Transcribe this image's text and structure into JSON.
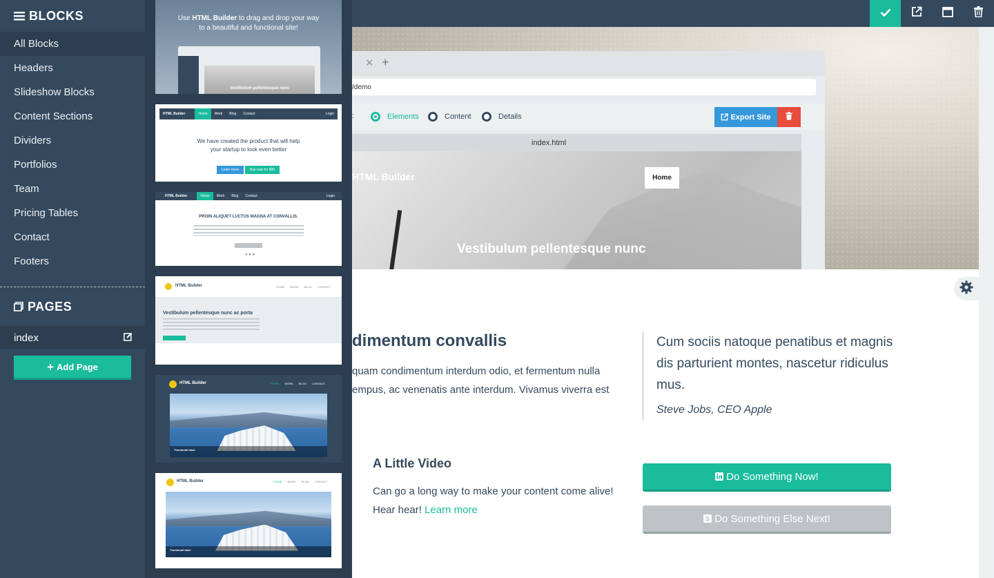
{
  "sidebar": {
    "blocks_title": "BLOCKS",
    "items": [
      {
        "label": "All Blocks"
      },
      {
        "label": "Headers"
      },
      {
        "label": "Slideshow Blocks"
      },
      {
        "label": "Content Sections"
      },
      {
        "label": "Dividers"
      },
      {
        "label": "Portfolios"
      },
      {
        "label": "Team"
      },
      {
        "label": "Pricing Tables"
      },
      {
        "label": "Contact"
      },
      {
        "label": "Footers"
      }
    ],
    "pages_title": "PAGES",
    "pages": [
      {
        "label": "index"
      }
    ],
    "add_page_label": "Add Page"
  },
  "thumbs": {
    "t1": {
      "line1a": "Use ",
      "line1b": "HTML Builder",
      "line1c": " to drag and drop your way",
      "line2": "to a beautiful and functional site!",
      "caption": "Vestibulum pellentesque nunc"
    },
    "t2": {
      "brand": "HTML Builder",
      "nav": [
        "Home",
        "Work",
        "Blog",
        "Contact"
      ],
      "login": "Login",
      "h1": "We have created the product that will help",
      "h2": "your startup to look even better",
      "btn1": "Learn more",
      "btn2": "Buy now for $99"
    },
    "t3": {
      "brand": "HTML Builder",
      "nav": [
        "Home",
        "Work",
        "Blog",
        "Contact"
      ],
      "login": "Login",
      "title": "PROIN ALIQUET LUCTUS MAGNA AT CONVALLIS."
    },
    "t4": {
      "brand": "HTML Builder",
      "nav": [
        "HOME",
        "WORK",
        "BLOG",
        "CONTACT"
      ],
      "title": "Vestibulum pellentesque nunc ac porta"
    },
    "t5": {
      "brand": "HTML Builder",
      "nav": [
        "HOME",
        "WORK",
        "BLOG",
        "CONTACT"
      ],
      "caption": "Thumbnail label"
    },
    "t6": {
      "brand": "HTML Builder",
      "nav": [
        "HOME",
        "WORK",
        "BLOG",
        "CONTACT"
      ],
      "caption": "Thumbnail label"
    }
  },
  "canvas": {
    "url_text": "/demo",
    "modes": [
      "Elements",
      "Content",
      "Details"
    ],
    "mode_prefix": ":",
    "export_label": "Export Site",
    "file_tab": "index.html",
    "inner_brand": "HTML Builder",
    "inner_home": "Home",
    "inner_caption": "Vestibulum pellentesque nunc",
    "section_heading": "dimentum convallis",
    "section_text": "quam condimentum interdum odio, et fermentum nulla empus, ac venenatis ante interdum. Vivamus viverra est",
    "quote": "Cum sociis natoque penatibus et magnis dis parturient montes, nascetur ridiculus mus.",
    "quote_author": "Steve Jobs, CEO Apple",
    "video_heading": "A Little Video",
    "video_text": "Can go a long way to make your content come alive! Hear hear! ",
    "video_link": "Learn more",
    "cta_primary": "Do Something Now!",
    "cta_secondary": "Do Something Else Next!"
  },
  "colors": {
    "sidebar": "#34495e",
    "sidebar_dark": "#2c3e50",
    "accent": "#1abc9c",
    "blue": "#3498db",
    "red": "#e74c3c"
  },
  "icons": [
    "check-icon",
    "external-link-icon",
    "window-icon",
    "trash-icon",
    "menu-icon",
    "copy-icon",
    "edit-icon",
    "plus-icon",
    "gear-icon",
    "linkedin-icon",
    "skype-icon"
  ]
}
